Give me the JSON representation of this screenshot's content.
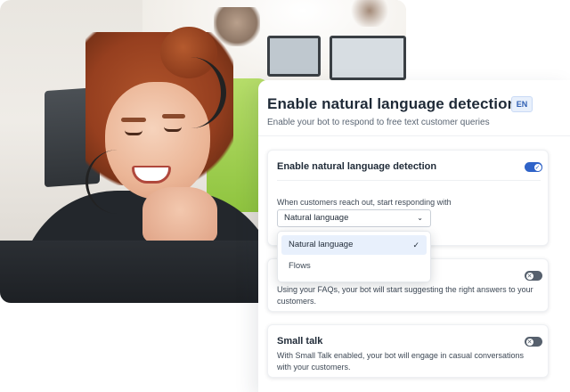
{
  "header": {
    "title": "Enable natural language detection",
    "language_badge": "EN",
    "subtitle": "Enable your bot to respond to free text customer queries"
  },
  "nl_card": {
    "title": "Enable natural language detection",
    "toggle_on": true,
    "respond_label": "When customers reach out, start responding with",
    "select_value": "Natural language",
    "chevron_icon": "chevron-down-icon",
    "options": [
      {
        "label": "Natural language",
        "selected": true
      },
      {
        "label": "Flows",
        "selected": false
      }
    ]
  },
  "faq_card": {
    "toggle_on": false,
    "description": "Using your FAQs, your bot will start suggesting the right answers to your customers."
  },
  "smalltalk_card": {
    "title": "Small talk",
    "toggle_on": false,
    "description": "With Small Talk enabled, your bot will engage in casual conversations with your customers."
  },
  "colors": {
    "accent": "#2f63c8",
    "toggle_off": "#56606d",
    "selected_option_bg": "#e8f0fc",
    "chair": "#8fc43f"
  }
}
